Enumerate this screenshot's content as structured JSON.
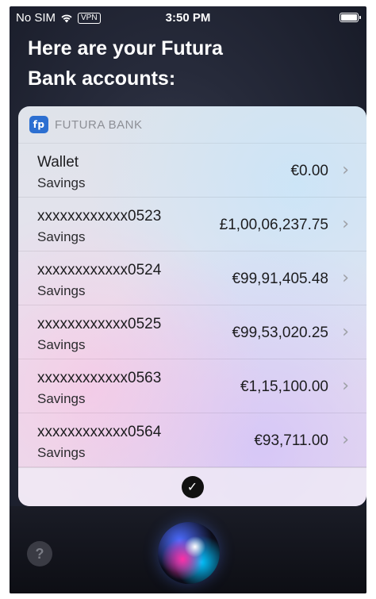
{
  "status_bar": {
    "carrier": "No SIM",
    "vpn": "VPN",
    "time": "3:50 PM"
  },
  "headline": {
    "line1": "Here are your Futura",
    "line2": "Bank accounts:"
  },
  "card": {
    "bank_name": "FUTURA BANK",
    "logo_text": "fp",
    "accounts": [
      {
        "name": "Wallet",
        "type": "Savings",
        "amount": "€0.00"
      },
      {
        "name": "xxxxxxxxxxxx0523",
        "type": "Savings",
        "amount": "£1,00,06,237.75"
      },
      {
        "name": "xxxxxxxxxxxx0524",
        "type": "Savings",
        "amount": "€99,91,405.48"
      },
      {
        "name": "xxxxxxxxxxxx0525",
        "type": "Savings",
        "amount": "€99,53,020.25"
      },
      {
        "name": "xxxxxxxxxxxx0563",
        "type": "Savings",
        "amount": "€1,15,100.00"
      },
      {
        "name": "xxxxxxxxxxxx0564",
        "type": "Savings",
        "amount": "€93,711.00"
      }
    ],
    "chevron": "›",
    "confirm_icon": "✓"
  },
  "bottom": {
    "help_label": "?"
  },
  "icons": {
    "wifi": "wifi-icon",
    "battery": "battery-icon",
    "siri": "siri-orb-icon",
    "check": "checkmark-icon"
  },
  "colors": {
    "logo_blue": "#2c6fd1"
  }
}
